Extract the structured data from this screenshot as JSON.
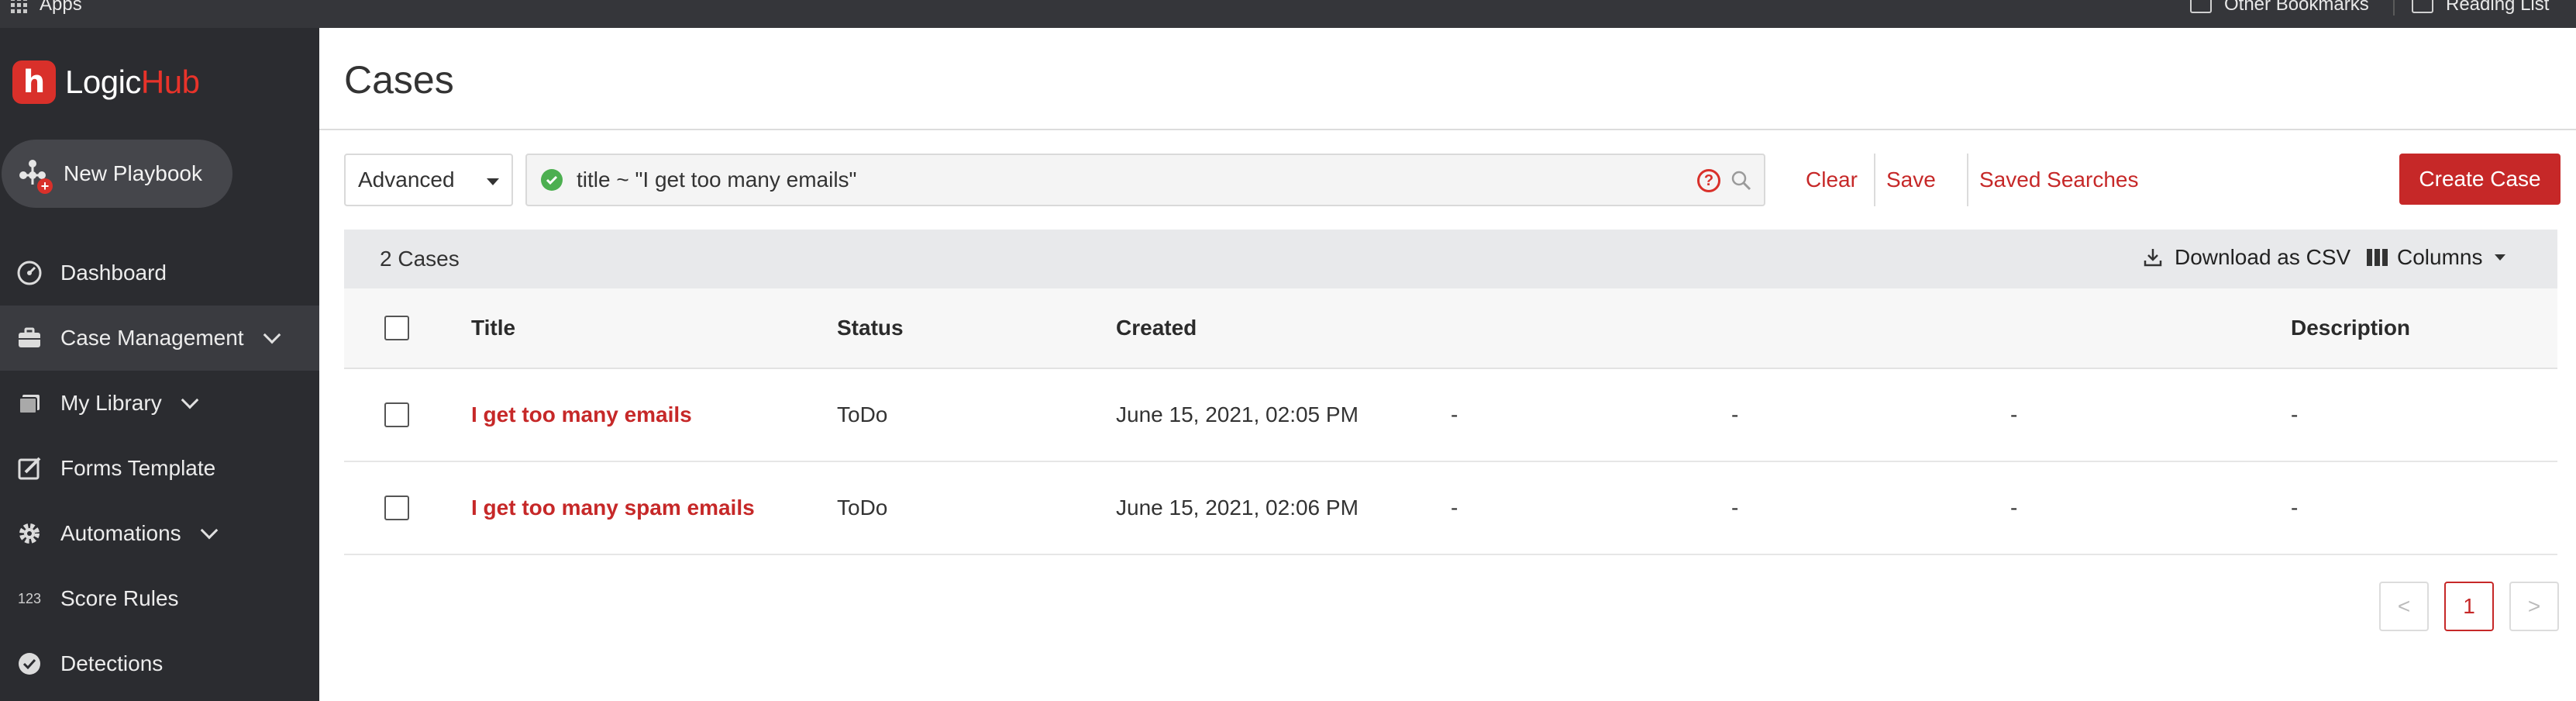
{
  "browser": {
    "bookmarks": {
      "apps": "Apps",
      "other": "Other Bookmarks",
      "reading": "Reading List"
    }
  },
  "brand": {
    "mark": "h",
    "name_part1": "Logic",
    "name_part2": "Hub",
    "accent": "#d9302a"
  },
  "sidebar": {
    "new_playbook": "New Playbook",
    "items": [
      {
        "label": "Dashboard",
        "icon": "dashboard-icon"
      },
      {
        "label": "Case Management",
        "icon": "briefcase-icon",
        "expandable": true,
        "active": true
      },
      {
        "label": "My Library",
        "icon": "library-icon",
        "expandable": true
      },
      {
        "label": "Forms Template",
        "icon": "edit-form-icon"
      },
      {
        "label": "Automations",
        "icon": "gear-icon",
        "expandable": true
      },
      {
        "label": "Score Rules",
        "icon_text": "123"
      },
      {
        "label": "Detections",
        "icon": "check-circle-icon"
      }
    ]
  },
  "main": {
    "title": "Cases",
    "search": {
      "mode": "Advanced",
      "query": "title ~ \"I get too many emails\"",
      "help": "?",
      "clear": "Clear",
      "save": "Save",
      "saved_searches": "Saved Searches"
    },
    "create_case": "Create Case",
    "table": {
      "count": "2 Cases",
      "download": "Download as CSV",
      "columns": "Columns",
      "headers": {
        "title": "Title",
        "status": "Status",
        "created": "Created",
        "description": "Description"
      },
      "rows": [
        {
          "title": "I get too many emails",
          "status": "ToDo",
          "created": "June 15, 2021, 02:05 PM",
          "d1": "-",
          "d2": "-",
          "d3": "-",
          "description": "-"
        },
        {
          "title": "I get too many spam emails",
          "status": "ToDo",
          "created": "June 15, 2021, 02:06 PM",
          "d1": "-",
          "d2": "-",
          "d3": "-",
          "description": "-"
        }
      ]
    },
    "pagination": {
      "current_page": "1",
      "prev": "<",
      "next": ">"
    }
  },
  "colors": {
    "link_red": "#c62828",
    "sidebar_bg": "#2b2c30",
    "valid_green": "#4caf50"
  }
}
